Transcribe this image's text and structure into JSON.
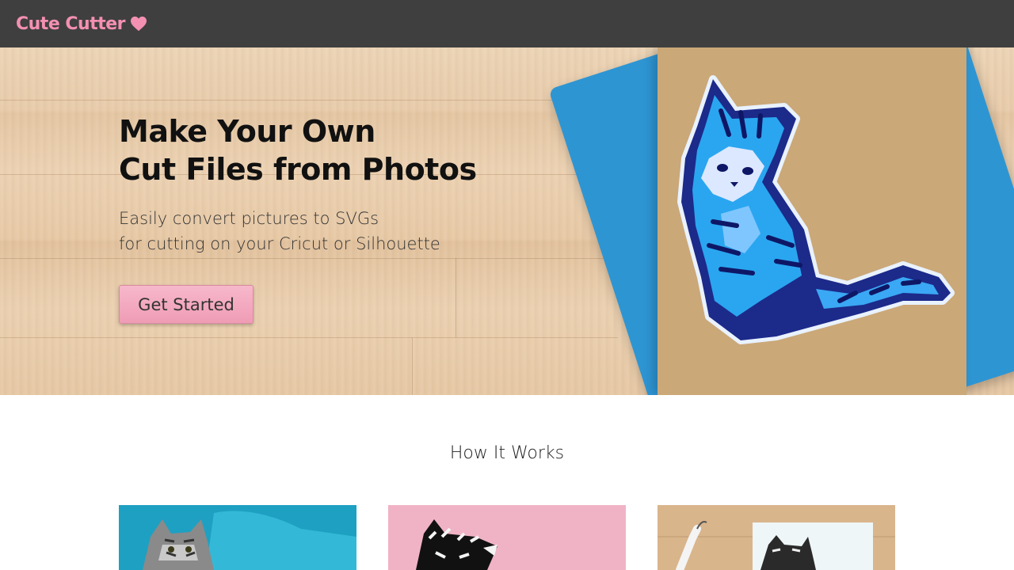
{
  "brand": {
    "name": "Cute Cutter",
    "accent": "#f490b2",
    "icon": "heart-icon"
  },
  "hero": {
    "title": "Make Your Own\nCut Files from Photos",
    "subtitle": "Easily convert pictures to SVGs\nfor cutting on your Cricut or Silhouette",
    "cta_label": "Get Started",
    "cta_color": "#f4a9bf"
  },
  "how_it_works": {
    "title": "How It Works",
    "cards": [
      {
        "image": "cat-on-blue-blanket-photo"
      },
      {
        "image": "cat-svg-on-pink-background"
      },
      {
        "image": "cut-cat-on-wood-with-tool"
      }
    ]
  },
  "colors": {
    "navbar": "#3f3f3f",
    "wood": "#e6c8a6",
    "blue": "#2e95d3",
    "pink": "#f0b3c5"
  }
}
